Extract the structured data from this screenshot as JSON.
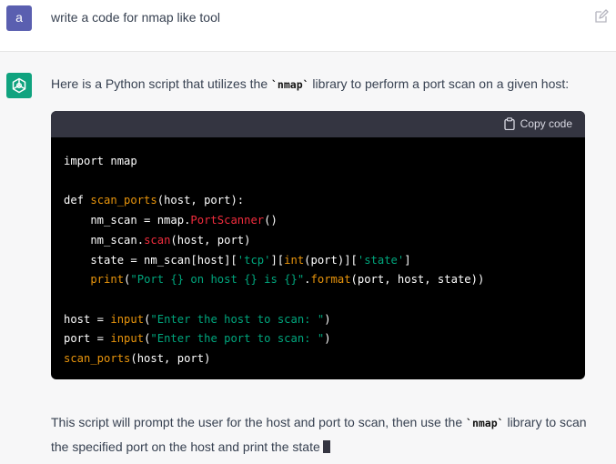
{
  "user": {
    "avatar_letter": "a",
    "message": "write a code for nmap like tool"
  },
  "assistant": {
    "intro_before": "Here is a Python script that utilizes the ",
    "intro_code": "`nmap`",
    "intro_after": " library to perform a port scan on a given host:",
    "copy_label": "Copy code",
    "outro_before": "This script will prompt the user for the host and port to scan, then use the ",
    "outro_code": "`nmap`",
    "outro_after": " library to scan the specified port on the host and print the state"
  },
  "code": {
    "line1": "import nmap",
    "line3_kw": "def ",
    "line3_fn": "scan_ports",
    "line3_rest": "(host, port):",
    "line4_a": "    nm_scan = nmap.",
    "line4_fn": "PortScanner",
    "line4_b": "()",
    "line5_a": "    nm_scan.",
    "line5_fn": "scan",
    "line5_b": "(host, port)",
    "line6_a": "    state = nm_scan[host][",
    "line6_s1": "'tcp'",
    "line6_b": "][",
    "line6_bi": "int",
    "line6_c": "(port)][",
    "line6_s2": "'state'",
    "line6_d": "]",
    "line7_bi": "    print",
    "line7_a": "(",
    "line7_s": "\"Port {} on host {} is {}\"",
    "line7_b": ".",
    "line7_fn": "format",
    "line7_c": "(port, host, state))",
    "line9_a": "host = ",
    "line9_bi": "input",
    "line9_b": "(",
    "line9_s": "\"Enter the host to scan: \"",
    "line9_c": ")",
    "line10_a": "port = ",
    "line10_bi": "input",
    "line10_b": "(",
    "line10_s": "\"Enter the port to scan: \"",
    "line10_c": ")",
    "line11_fn": "scan_ports",
    "line11_a": "(host, port)"
  }
}
